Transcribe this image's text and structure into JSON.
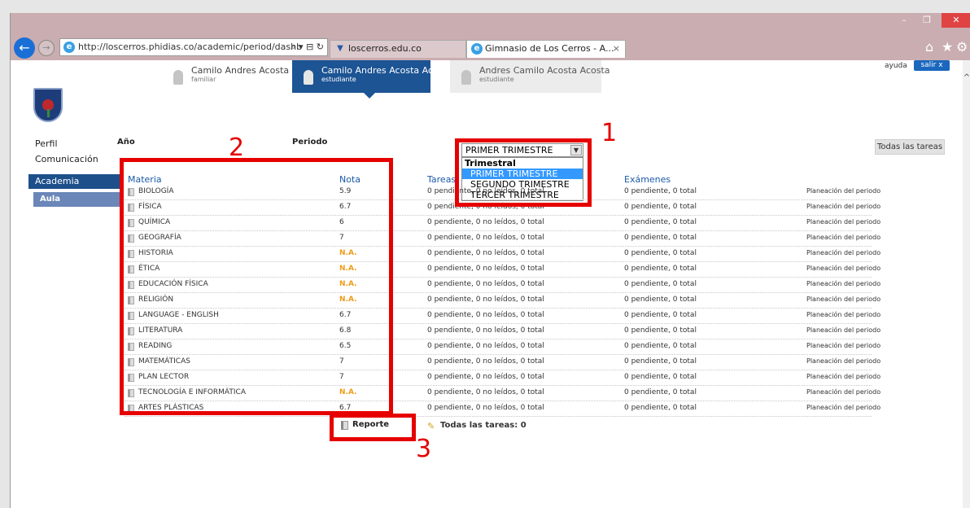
{
  "browser": {
    "url": "http://loscerros.phidias.co/academic/period/dashb",
    "url_tools": "⌕ ▾ ⊟ ↻",
    "tabs": [
      {
        "label": "loscerros.edu.co",
        "close": ""
      },
      {
        "label": "Gimnasio de Los Cerros - A...",
        "close": "×"
      }
    ]
  },
  "header": {
    "users": [
      {
        "name": "Camilo Andres Acosta",
        "role": "familiar"
      },
      {
        "name": "Camilo Andres Acosta Acosta",
        "role": "estudiante"
      },
      {
        "name": "Andres Camilo Acosta Acosta",
        "role": "estudiante"
      }
    ],
    "help": "ayuda",
    "logout": "salir x"
  },
  "sidebar": {
    "items": [
      "Perfil",
      "Comunicación",
      "Academia",
      "Aula"
    ]
  },
  "filters": {
    "year_label": "Año",
    "period_label": "Periodo",
    "selected": "PRIMER TRIMESTRE",
    "group": "Trimestral",
    "options": [
      "PRIMER TRIMESTRE",
      "SEGUNDO TRIMESTRE",
      "TERCER TRIMESTRE"
    ],
    "all_tasks_button": "Todas las tareas"
  },
  "table": {
    "headers": {
      "subject": "Materia",
      "grade": "Nota",
      "tasks": "Tareas",
      "exams": "Exámenes"
    },
    "rows": [
      {
        "subject": "BIOLOGÍA",
        "grade": "5.9",
        "tasks": "0 pendiente, 0 no leídos, 0 total",
        "exams": "0 pendiente, 0 total",
        "plan": "Planeación del periodo"
      },
      {
        "subject": "FÍSICA",
        "grade": "6.7",
        "tasks": "0 pendiente, 0 no leídos, 0 total",
        "exams": "0 pendiente, 0 total",
        "plan": "Planeación del periodo"
      },
      {
        "subject": "QUÍMICA",
        "grade": "6",
        "tasks": "0 pendiente, 0 no leídos, 0 total",
        "exams": "0 pendiente, 0 total",
        "plan": "Planeación del periodo"
      },
      {
        "subject": "GEOGRAFÍA",
        "grade": "7",
        "tasks": "0 pendiente, 0 no leídos, 0 total",
        "exams": "0 pendiente, 0 total",
        "plan": "Planeación del periodo"
      },
      {
        "subject": "HISTORIA",
        "grade": "N.A.",
        "tasks": "0 pendiente, 0 no leídos, 0 total",
        "exams": "0 pendiente, 0 total",
        "plan": "Planeación del periodo"
      },
      {
        "subject": "ÉTICA",
        "grade": "N.A.",
        "tasks": "0 pendiente, 0 no leídos, 0 total",
        "exams": "0 pendiente, 0 total",
        "plan": "Planeación del periodo"
      },
      {
        "subject": "EDUCACIÓN FÍSICA",
        "grade": "N.A.",
        "tasks": "0 pendiente, 0 no leídos, 0 total",
        "exams": "0 pendiente, 0 total",
        "plan": "Planeación del periodo"
      },
      {
        "subject": "RELIGIÓN",
        "grade": "N.A.",
        "tasks": "0 pendiente, 0 no leídos, 0 total",
        "exams": "0 pendiente, 0 total",
        "plan": "Planeación del periodo"
      },
      {
        "subject": "LANGUAGE - ENGLISH",
        "grade": "6.7",
        "tasks": "0 pendiente, 0 no leídos, 0 total",
        "exams": "0 pendiente, 0 total",
        "plan": "Planeación del periodo"
      },
      {
        "subject": "LITERATURA",
        "grade": "6.8",
        "tasks": "0 pendiente, 0 no leídos, 0 total",
        "exams": "0 pendiente, 0 total",
        "plan": "Planeación del periodo"
      },
      {
        "subject": "READING",
        "grade": "6.5",
        "tasks": "0 pendiente, 0 no leídos, 0 total",
        "exams": "0 pendiente, 0 total",
        "plan": "Planeación del periodo"
      },
      {
        "subject": "MATEMÁTICAS",
        "grade": "7",
        "tasks": "0 pendiente, 0 no leídos, 0 total",
        "exams": "0 pendiente, 0 total",
        "plan": "Planeación del periodo"
      },
      {
        "subject": "PLAN LECTOR",
        "grade": "7",
        "tasks": "0 pendiente, 0 no leídos, 0 total",
        "exams": "0 pendiente, 0 total",
        "plan": "Planeación del periodo"
      },
      {
        "subject": "TECNOLOGÍA E INFORMÁTICA",
        "grade": "N.A.",
        "tasks": "0 pendiente, 0 no leídos, 0 total",
        "exams": "0 pendiente, 0 total",
        "plan": "Planeación del periodo"
      },
      {
        "subject": "ARTES PLÁSTICAS",
        "grade": "6.7",
        "tasks": "0 pendiente, 0 no leídos, 0 total",
        "exams": "0 pendiente, 0 total",
        "plan": "Planeación del periodo"
      }
    ]
  },
  "footer": {
    "report_label": "Reporte",
    "all_tasks_count": "Todas las tareas: 0"
  },
  "annotations": [
    "1",
    "2",
    "3"
  ],
  "colors": {
    "highlight": "#e60000",
    "na_grade": "#ef9c1a",
    "header_blue": "#1a59a8",
    "active_user": "#1c5494"
  }
}
